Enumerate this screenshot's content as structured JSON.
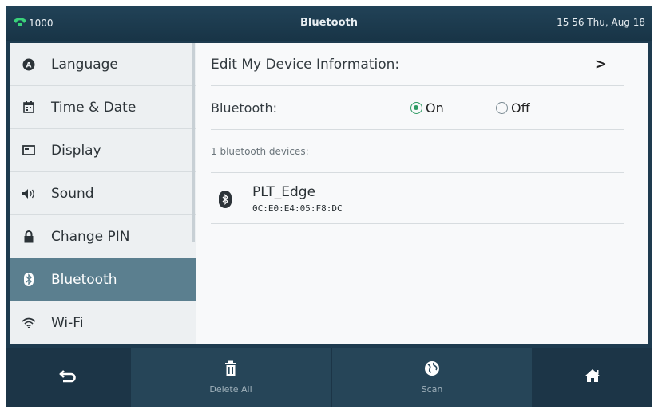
{
  "statusbar": {
    "line_number": "1000",
    "title": "Bluetooth",
    "datetime": "15 56 Thu, Aug 18",
    "phone_icon": "phone-handset-icon"
  },
  "menu": {
    "items": [
      {
        "label": "Language",
        "icon": "language-icon"
      },
      {
        "label": "Time & Date",
        "icon": "calendar-icon"
      },
      {
        "label": "Display",
        "icon": "display-icon"
      },
      {
        "label": "Sound",
        "icon": "speaker-icon"
      },
      {
        "label": "Change PIN",
        "icon": "lock-icon"
      },
      {
        "label": "Bluetooth",
        "icon": "bluetooth-icon",
        "active": true
      },
      {
        "label": "Wi-Fi",
        "icon": "wifi-icon"
      }
    ]
  },
  "content": {
    "edit_device_label": "Edit My Device Information:",
    "edit_chevron": ">",
    "bluetooth_label": "Bluetooth:",
    "on_label": "On",
    "off_label": "Off",
    "device_count": "1 bluetooth devices:",
    "devices": [
      {
        "name": "PLT_Edge",
        "mac": "0C:E0:E4:05:F8:DC"
      }
    ]
  },
  "softkeys": {
    "delete_all": "Delete All",
    "scan": "Scan"
  },
  "colors": {
    "active_item": "#5b7f8f",
    "radio_on": "#2e9a63",
    "status_bg": "#1e3b4f"
  }
}
